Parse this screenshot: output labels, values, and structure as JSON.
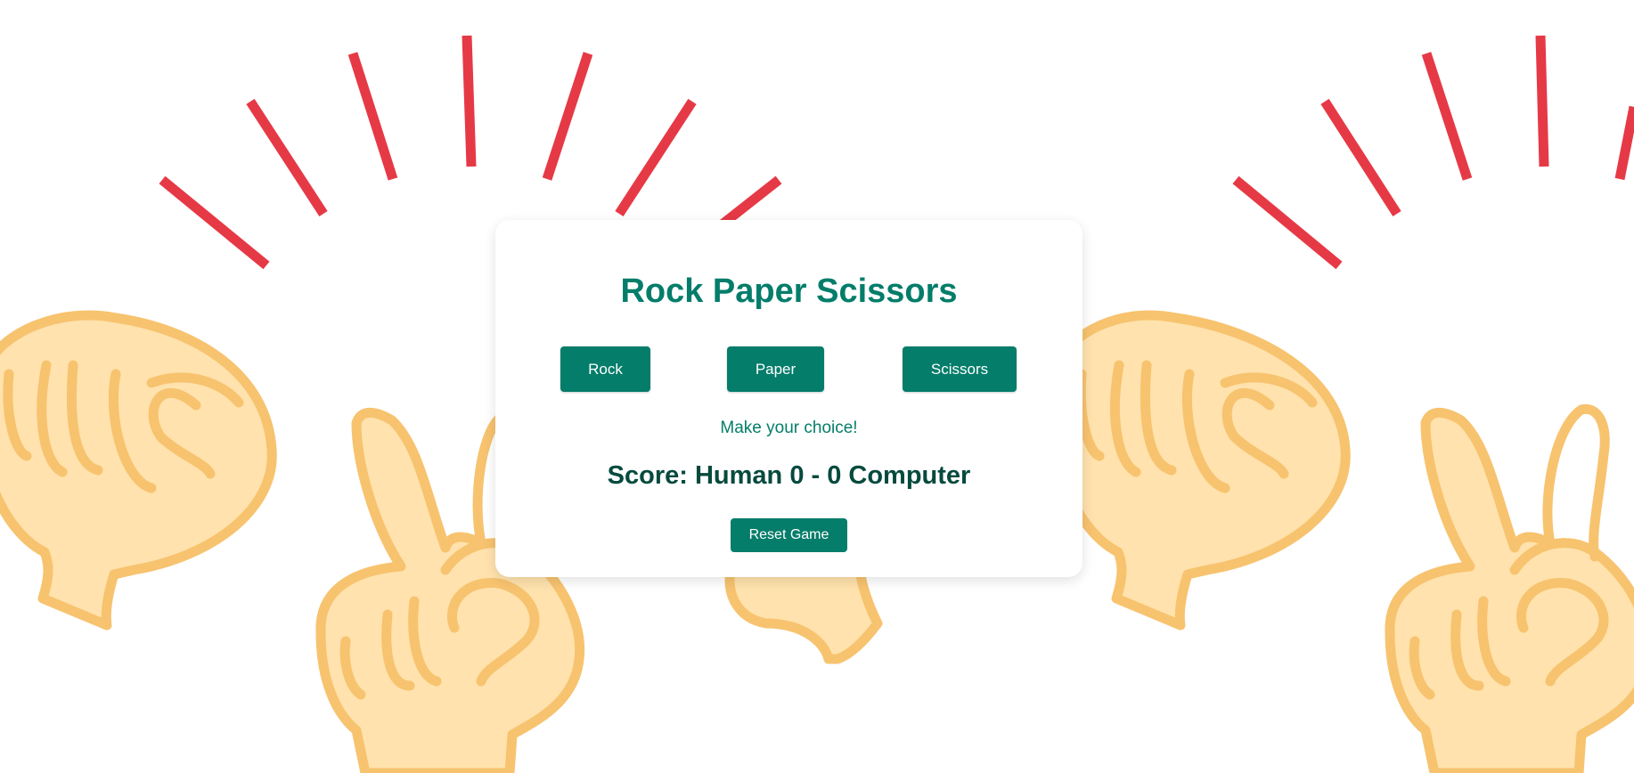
{
  "game": {
    "title": "Rock Paper Scissors",
    "choices": {
      "rock": "Rock",
      "paper": "Paper",
      "scissors": "Scissors"
    },
    "message": "Make your choice!",
    "score_text": "Score: Human 0 - 0 Computer",
    "reset_label": "Reset Game"
  },
  "colors": {
    "accent": "#047d6a",
    "score_text": "#064a3e",
    "burst_lines": "#e63946",
    "hand_fill": "#ffe2ad",
    "hand_outline": "#f7c36f"
  },
  "background": {
    "icons": [
      "burst-lines",
      "fist-hand-icon",
      "peace-sign-hand-icon"
    ]
  }
}
